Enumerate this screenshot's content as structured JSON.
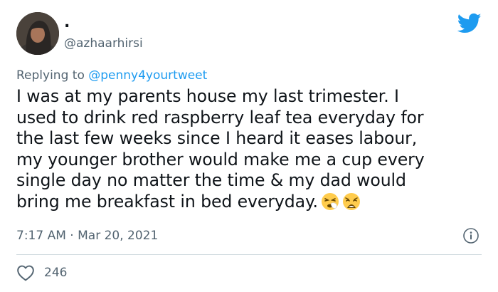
{
  "author": {
    "display_name": ".",
    "handle": "@azhaarhirsi"
  },
  "reply": {
    "prefix": "Replying to ",
    "to_handle": "@penny4yourtweet"
  },
  "tweet": {
    "lines": [
      "I was at my parents house my last trimester. I",
      "used to drink red raspberry leaf tea everyday for",
      "the last few weeks since I heard it eases labour,",
      "my younger brother would make me a cup every",
      "single day no matter the time & my dad would",
      "bring me breakfast in bed everyday."
    ],
    "emojis": [
      "sneezing-face",
      "weary-face"
    ]
  },
  "meta": {
    "time": "7:17 AM",
    "separator": " · ",
    "date": "Mar 20, 2021"
  },
  "stats": {
    "likes": "246"
  },
  "colors": {
    "brand_blue": "#1d9bf0",
    "secondary_text": "#536471",
    "divider": "#cfd9de"
  }
}
